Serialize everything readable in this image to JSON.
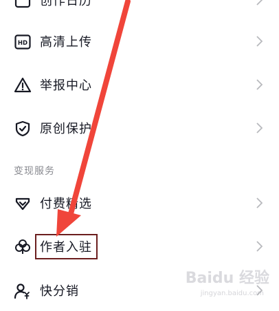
{
  "menu": {
    "items": [
      {
        "id": "create",
        "label": "创作日历",
        "icon": "calendar-icon"
      },
      {
        "id": "hd-upload",
        "label": "高清上传",
        "icon": "hd-icon"
      },
      {
        "id": "report",
        "label": "举报中心",
        "icon": "warning-icon"
      },
      {
        "id": "original",
        "label": "原创保护",
        "icon": "shield-check-icon"
      }
    ]
  },
  "monetize": {
    "section_title": "变现服务",
    "items": [
      {
        "id": "paid",
        "label": "付费精选",
        "icon": "diamond-icon"
      },
      {
        "id": "author",
        "label": "作者入驻",
        "icon": "clover-icon"
      },
      {
        "id": "distribution",
        "label": "快分销",
        "icon": "user-yen-icon"
      }
    ]
  },
  "watermark": {
    "text": "Baidu 经验",
    "url": "jingyan.baidu.com"
  },
  "colors": {
    "arrow": "#f0453a",
    "highlight_border": "#6b1e1e",
    "section_text": "#8a8b91"
  }
}
